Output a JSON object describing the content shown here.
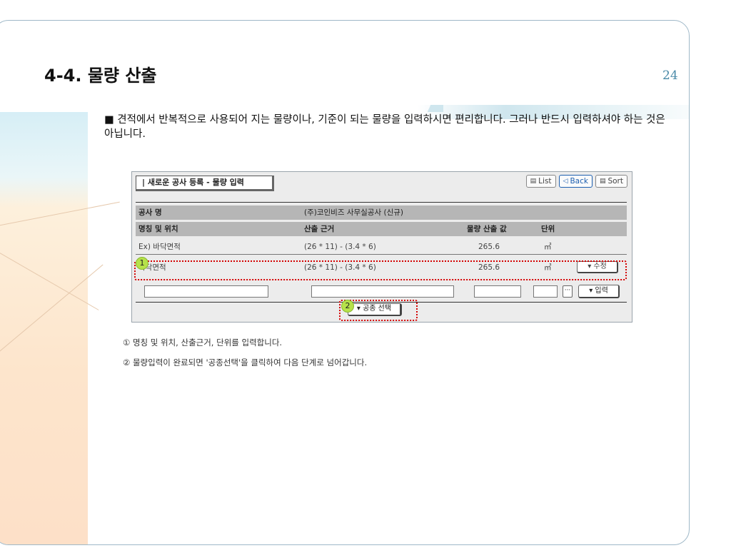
{
  "slide": {
    "title": "4-4. 물량 산출",
    "page_number": "24",
    "description": "■ 견적에서 반복적으로 사용되어 지는 물량이나, 기준이 되는 물량을 입력하시면 편리합니다. 그러나 반드시 입력하셔야 하는 것은 아닙니다."
  },
  "app": {
    "window_title": "| 새로운 공사 등록 - 물량 입력",
    "buttons": {
      "list": "List",
      "back": "Back",
      "sort": "Sort"
    },
    "project": {
      "label": "공사 명",
      "value": "(주)코인비즈 사무실공사 (신규)"
    },
    "columns": [
      "명칭 및 위치",
      "산출 근거",
      "물량 산출 값",
      "단위"
    ],
    "rows": [
      {
        "name": "Ex) 바닥면적",
        "basis": "(26 * 11) - (3.4 * 6)",
        "value": "265.6",
        "unit": "㎡"
      },
      {
        "name": "바닥면적",
        "basis": "(26 * 11) - (3.4 * 6)",
        "value": "265.6",
        "unit": "㎡",
        "action": "▾ 수정"
      }
    ],
    "input_row": {
      "dots": "···",
      "enter_label": "▾ 입력"
    },
    "select_label": "▾ 공종 선택"
  },
  "callouts": {
    "one": "1",
    "two": "2"
  },
  "notes": {
    "one": "① 명칭 및 위치, 산출근거, 단위를 입력합니다.",
    "two": "② 물량입력이 완료되면 '공종선택'을 클릭하여 다음 단계로 넘어갑니다."
  }
}
